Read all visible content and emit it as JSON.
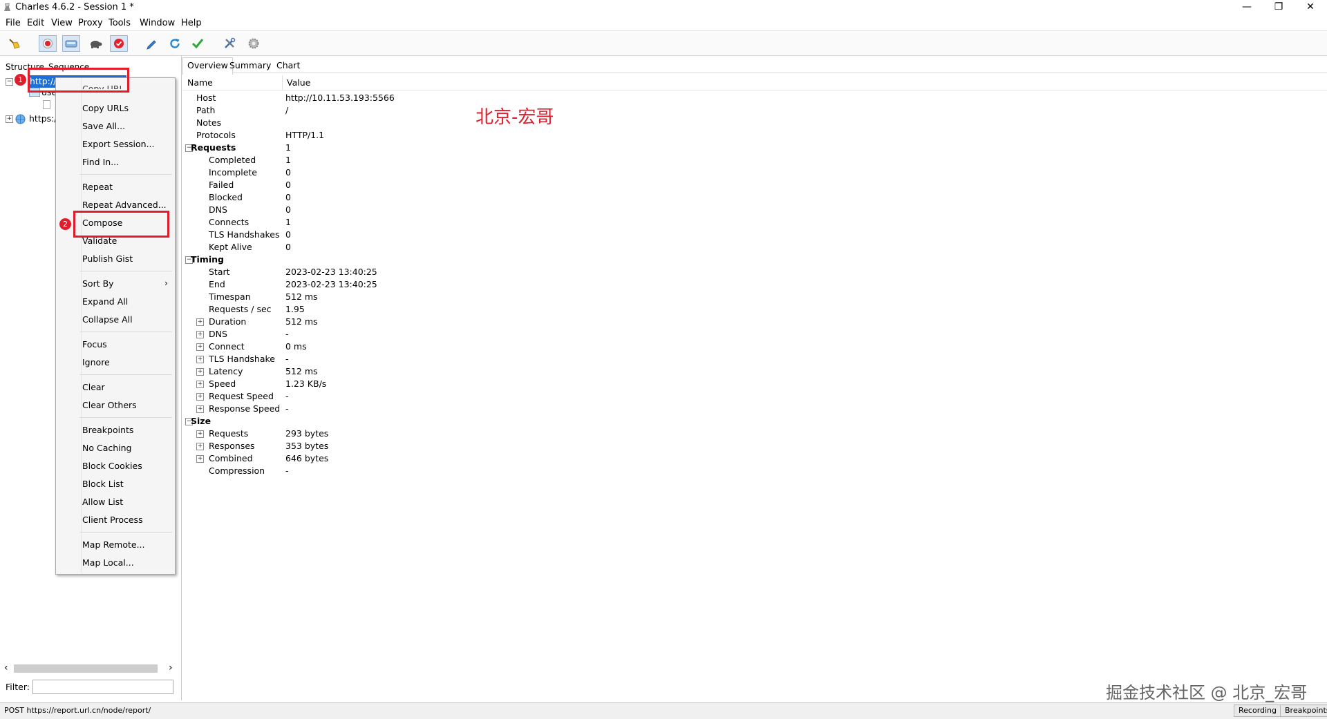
{
  "window": {
    "title": "Charles 4.6.2 - Session 1 *",
    "minimize": "—",
    "restore": "❐",
    "close": "✕"
  },
  "menu": [
    "File",
    "Edit",
    "View",
    "Proxy",
    "Tools",
    "Window",
    "Help"
  ],
  "toolbar": {
    "icons": [
      "broom-icon",
      "record-icon",
      "throttle-icon",
      "turtle-icon",
      "breakpoint-icon",
      "pen-icon",
      "refresh-icon",
      "check-icon",
      "tools-icon",
      "settings-icon"
    ]
  },
  "left": {
    "tabs": [
      "Structure",
      "Sequence"
    ],
    "tree": {
      "host_selected": "http://10.11.53.193:5566",
      "child_partial": "use",
      "https_partial": "https:/"
    },
    "filter_label": "Filter:",
    "scroll_left": "‹",
    "scroll_right": "›"
  },
  "context_menu": {
    "hidden_top": "Copy URL",
    "group1": [
      "Copy URLs",
      "Save All...",
      "Export Session...",
      "Find In..."
    ],
    "group2": [
      "Repeat",
      "Repeat Advanced...",
      "Compose",
      "Validate",
      "Publish Gist"
    ],
    "group3": [
      "Sort By",
      "Expand All",
      "Collapse All"
    ],
    "group4": [
      "Focus",
      "Ignore"
    ],
    "group5": [
      "Clear",
      "Clear Others"
    ],
    "group6": [
      "Breakpoints",
      "No Caching",
      "Block Cookies",
      "Block List",
      "Allow List",
      "Client Process"
    ],
    "group7": [
      "Map Remote...",
      "Map Local..."
    ],
    "submenu_arrow": "›"
  },
  "annotations": {
    "badge1": "1",
    "badge2": "2",
    "watermark_red": "北京-宏哥",
    "watermark_bottom": "掘金技术社区 @ 北京_宏哥",
    "color": "#e11c2b"
  },
  "right": {
    "tabs": [
      "Overview",
      "Summary",
      "Chart"
    ],
    "header": {
      "name": "Name",
      "value": "Value"
    },
    "rows": [
      {
        "name": "Host",
        "value": "http://10.11.53.193:5566",
        "level": 1,
        "bold": false,
        "expander": ""
      },
      {
        "name": "Path",
        "value": "/",
        "level": 1,
        "bold": false,
        "expander": ""
      },
      {
        "name": "Notes",
        "value": "",
        "level": 1,
        "bold": false,
        "expander": ""
      },
      {
        "name": "Protocols",
        "value": "HTTP/1.1",
        "level": 1,
        "bold": false,
        "expander": ""
      },
      {
        "name": "Requests",
        "value": "1",
        "level": 0,
        "bold": true,
        "expander": "−"
      },
      {
        "name": "Completed",
        "value": "1",
        "level": 2,
        "bold": false,
        "expander": ""
      },
      {
        "name": "Incomplete",
        "value": "0",
        "level": 2,
        "bold": false,
        "expander": ""
      },
      {
        "name": "Failed",
        "value": "0",
        "level": 2,
        "bold": false,
        "expander": ""
      },
      {
        "name": "Blocked",
        "value": "0",
        "level": 2,
        "bold": false,
        "expander": ""
      },
      {
        "name": "DNS",
        "value": "0",
        "level": 2,
        "bold": false,
        "expander": ""
      },
      {
        "name": "Connects",
        "value": "1",
        "level": 2,
        "bold": false,
        "expander": ""
      },
      {
        "name": "TLS Handshakes",
        "value": "0",
        "level": 2,
        "bold": false,
        "expander": ""
      },
      {
        "name": "Kept Alive",
        "value": "0",
        "level": 2,
        "bold": false,
        "expander": ""
      },
      {
        "name": "Timing",
        "value": "",
        "level": 0,
        "bold": true,
        "expander": "−"
      },
      {
        "name": "Start",
        "value": "2023-02-23 13:40:25",
        "level": 2,
        "bold": false,
        "expander": ""
      },
      {
        "name": "End",
        "value": "2023-02-23 13:40:25",
        "level": 2,
        "bold": false,
        "expander": ""
      },
      {
        "name": "Timespan",
        "value": "512 ms",
        "level": 2,
        "bold": false,
        "expander": ""
      },
      {
        "name": "Requests / sec",
        "value": "1.95",
        "level": 2,
        "bold": false,
        "expander": ""
      },
      {
        "name": "Duration",
        "value": "512 ms",
        "level": 2,
        "bold": false,
        "expander": "+"
      },
      {
        "name": "DNS",
        "value": "-",
        "level": 2,
        "bold": false,
        "expander": "+"
      },
      {
        "name": "Connect",
        "value": "0 ms",
        "level": 2,
        "bold": false,
        "expander": "+"
      },
      {
        "name": "TLS Handshake",
        "value": "-",
        "level": 2,
        "bold": false,
        "expander": "+"
      },
      {
        "name": "Latency",
        "value": "512 ms",
        "level": 2,
        "bold": false,
        "expander": "+"
      },
      {
        "name": "Speed",
        "value": "1.23 KB/s",
        "level": 2,
        "bold": false,
        "expander": "+"
      },
      {
        "name": "Request Speed",
        "value": "-",
        "level": 2,
        "bold": false,
        "expander": "+"
      },
      {
        "name": "Response Speed",
        "value": "-",
        "level": 2,
        "bold": false,
        "expander": "+"
      },
      {
        "name": "Size",
        "value": "",
        "level": 0,
        "bold": true,
        "expander": "−"
      },
      {
        "name": "Requests",
        "value": "293 bytes",
        "level": 2,
        "bold": false,
        "expander": "+"
      },
      {
        "name": "Responses",
        "value": "353 bytes",
        "level": 2,
        "bold": false,
        "expander": "+"
      },
      {
        "name": "Combined",
        "value": "646 bytes",
        "level": 2,
        "bold": false,
        "expander": "+"
      },
      {
        "name": "Compression",
        "value": "-",
        "level": 2,
        "bold": false,
        "expander": ""
      }
    ]
  },
  "status": {
    "text": "POST https://report.url.cn/node/report/",
    "recording": "Recording",
    "breakpoints": "Breakpoints"
  }
}
